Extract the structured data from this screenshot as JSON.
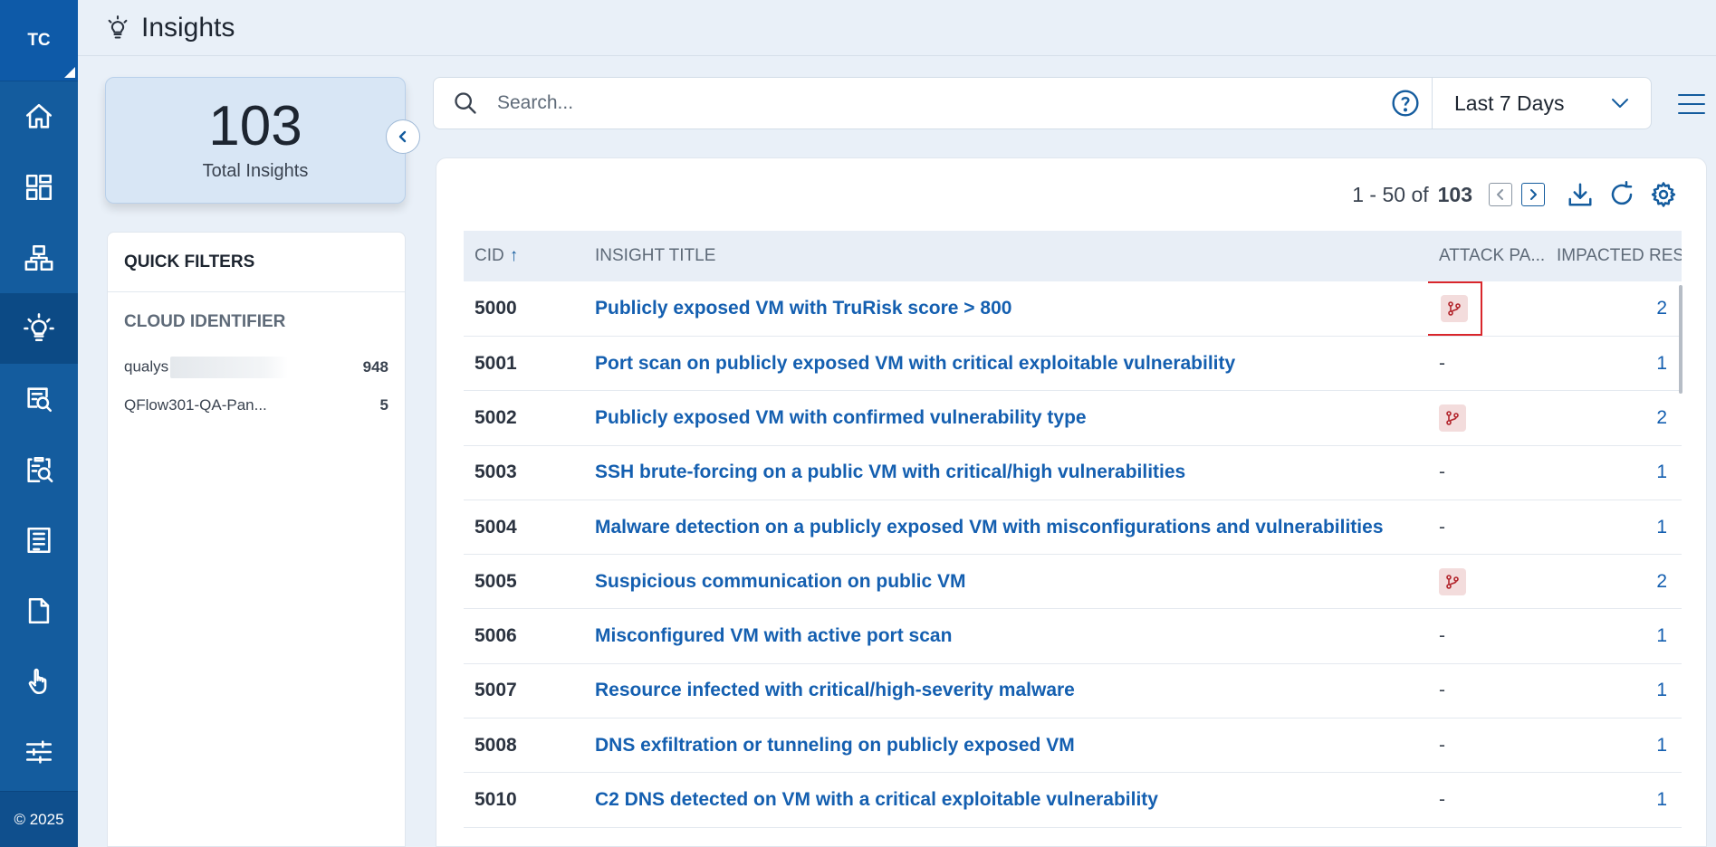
{
  "nav": {
    "logo": "TC",
    "items": [
      "home",
      "dashboard",
      "inventory",
      "insights",
      "explorer",
      "investigate",
      "reports",
      "documents",
      "touch",
      "settings"
    ],
    "active": "insights",
    "copyright": "© 2025"
  },
  "header": {
    "title": "Insights"
  },
  "summary": {
    "count": "103",
    "label": "Total Insights"
  },
  "filters": {
    "title": "QUICK FILTERS",
    "section_title": "CLOUD IDENTIFIER",
    "items": [
      {
        "label": "qualys",
        "count": "948"
      },
      {
        "label": "QFlow301-QA-Pan...",
        "count": "5"
      }
    ]
  },
  "search": {
    "placeholder": "Search..."
  },
  "date_range": {
    "selected": "Last 7 Days"
  },
  "pagination": {
    "range": "1 - 50 of",
    "total": "103"
  },
  "table": {
    "columns": {
      "cid": "CID",
      "title": "INSIGHT TITLE",
      "attack_path": "ATTACK PA...",
      "impacted": "IMPACTED RESOL"
    },
    "rows": [
      {
        "cid": "5000",
        "title": "Publicly exposed VM with TruRisk score > 800",
        "attack_path": "icon",
        "impacted": "2"
      },
      {
        "cid": "5001",
        "title": "Port scan on publicly exposed VM with critical exploitable vulnerability",
        "attack_path": "-",
        "impacted": "1"
      },
      {
        "cid": "5002",
        "title": "Publicly exposed VM with confirmed vulnerability type",
        "attack_path": "icon",
        "impacted": "2"
      },
      {
        "cid": "5003",
        "title": "SSH brute-forcing on a public VM with critical/high vulnerabilities",
        "attack_path": "-",
        "impacted": "1"
      },
      {
        "cid": "5004",
        "title": "Malware detection on a publicly exposed VM with misconfigurations and vulnerabilities",
        "attack_path": "-",
        "impacted": "1"
      },
      {
        "cid": "5005",
        "title": "Suspicious communication on public VM",
        "attack_path": "icon",
        "impacted": "2"
      },
      {
        "cid": "5006",
        "title": "Misconfigured VM with active port scan",
        "attack_path": "-",
        "impacted": "1"
      },
      {
        "cid": "5007",
        "title": "Resource infected with critical/high-severity malware",
        "attack_path": "-",
        "impacted": "1"
      },
      {
        "cid": "5008",
        "title": "DNS exfiltration or tunneling on publicly exposed VM",
        "attack_path": "-",
        "impacted": "1"
      },
      {
        "cid": "5010",
        "title": "C2 DNS detected on VM with a critical exploitable vulnerability",
        "attack_path": "-",
        "impacted": "1"
      }
    ]
  },
  "colors": {
    "nav": "#145c9e",
    "accent": "#145fb0",
    "highlight": "#d9262b"
  }
}
